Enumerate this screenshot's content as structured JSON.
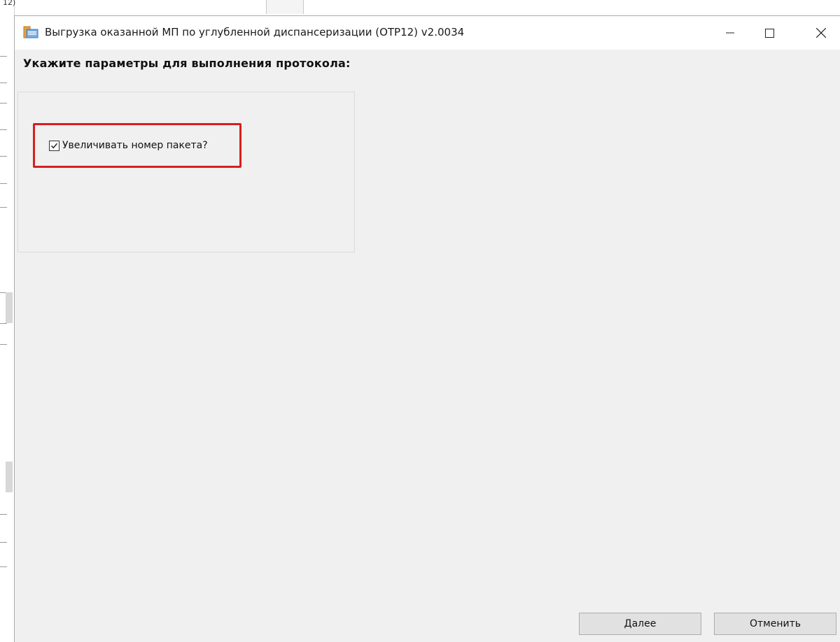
{
  "background": {
    "top_label": "12)"
  },
  "window": {
    "title": "Выгрузка  оказанной МП по углубленной диспансеризации (ОТР12) v2.0034",
    "controls": {
      "minimize": "minimize-icon",
      "maximize": "maximize-icon",
      "close": "close-icon"
    }
  },
  "main": {
    "heading": "Укажите параметры для выполнения протокола:",
    "options": [
      {
        "label": "Увеличивать номер пакета?",
        "checked": true
      }
    ],
    "highlight_color": "#d81e1e"
  },
  "footer": {
    "next_label": "Далее",
    "cancel_label": "Отменить"
  }
}
